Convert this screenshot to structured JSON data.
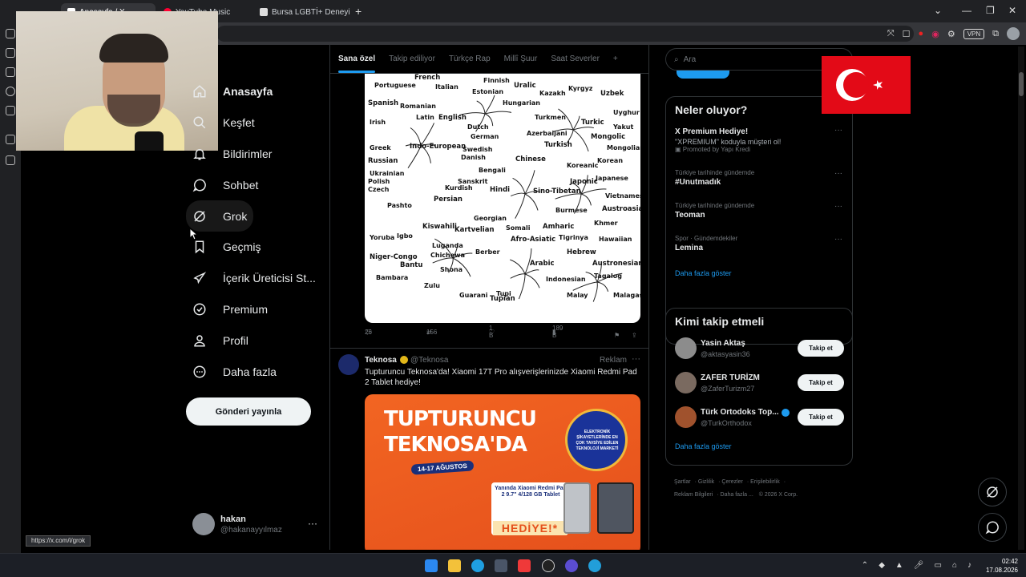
{
  "browser": {
    "tabs": [
      {
        "title": "Anasayfa / X",
        "active": true,
        "color": "#ffffff"
      },
      {
        "title": "YouTube Music",
        "active": false,
        "color": "#ff0033"
      },
      {
        "title": "Bursa LGBTİ+ Deneyimi Öz",
        "active": false,
        "color": "#dddddd"
      }
    ],
    "new_tab": "+",
    "status_url": "https://x.com/i/grok",
    "vpn_label": "VPN"
  },
  "nav": {
    "items": [
      {
        "label": "Anasayfa",
        "icon": "home-icon"
      },
      {
        "label": "Keşfet",
        "icon": "search-icon"
      },
      {
        "label": "Bildirimler",
        "icon": "bell-icon"
      },
      {
        "label": "Sohbet",
        "icon": "chat-icon"
      },
      {
        "label": "Grok",
        "icon": "grok-icon"
      },
      {
        "label": "Geçmiş",
        "icon": "bookmark-icon"
      },
      {
        "label": "İçerik Üreticisi St...",
        "icon": "rocket-icon"
      },
      {
        "label": "Premium",
        "icon": "verified-icon"
      },
      {
        "label": "Profil",
        "icon": "person-icon"
      },
      {
        "label": "Daha fazla",
        "icon": "more-circle-icon"
      }
    ],
    "post_button": "Gönderi yayınla",
    "profile": {
      "name": "hakan",
      "handle": "@hakanayyılmaz",
      "more": "···"
    }
  },
  "timeline": {
    "tabs": [
      "Sana özel",
      "Takip ediliyor",
      "Türkçe Rap",
      "Millî Şuur",
      "Saat Severler"
    ],
    "tab_add": "+",
    "post1": {
      "languages": [
        {
          "text": "French",
          "big": true
        },
        {
          "text": "Portuguese",
          "big": false
        },
        {
          "text": "Italian",
          "big": false
        },
        {
          "text": "Spanish",
          "big": true
        },
        {
          "text": "Romanian",
          "big": false
        },
        {
          "text": "Latin",
          "big": false
        },
        {
          "text": "English",
          "big": true
        },
        {
          "text": "Dutch",
          "big": false
        },
        {
          "text": "German",
          "big": false
        },
        {
          "text": "Swedish",
          "big": false
        },
        {
          "text": "Danish",
          "big": false
        },
        {
          "text": "Irish",
          "big": false
        },
        {
          "text": "Greek",
          "big": false
        },
        {
          "text": "Indo-European",
          "big": true
        },
        {
          "text": "Russian",
          "big": true
        },
        {
          "text": "Ukrainian",
          "big": false
        },
        {
          "text": "Polish",
          "big": false
        },
        {
          "text": "Czech",
          "big": false
        },
        {
          "text": "Pashto",
          "big": false
        },
        {
          "text": "Persian",
          "big": true
        },
        {
          "text": "Kurdish",
          "big": false
        },
        {
          "text": "Bengali",
          "big": false
        },
        {
          "text": "Hindi",
          "big": true
        },
        {
          "text": "Sanskrit",
          "big": false
        },
        {
          "text": "Finnish",
          "big": false
        },
        {
          "text": "Estonian",
          "big": false
        },
        {
          "text": "Uralic",
          "big": true
        },
        {
          "text": "Hungarian",
          "big": false
        },
        {
          "text": "Kazakh",
          "big": false
        },
        {
          "text": "Kyrgyz",
          "big": false
        },
        {
          "text": "Uzbek",
          "big": true
        },
        {
          "text": "Turkmen",
          "big": false
        },
        {
          "text": "Azerbaijani",
          "big": false
        },
        {
          "text": "Turkic",
          "big": true
        },
        {
          "text": "Turkish",
          "big": true
        },
        {
          "text": "Mongolic",
          "big": true
        },
        {
          "text": "Uyghur",
          "big": false
        },
        {
          "text": "Yakut",
          "big": false
        },
        {
          "text": "Mongolian",
          "big": false
        },
        {
          "text": "Chinese",
          "big": true
        },
        {
          "text": "Koreanic",
          "big": false
        },
        {
          "text": "Korean",
          "big": false
        },
        {
          "text": "Japonic",
          "big": true
        },
        {
          "text": "Japanese",
          "big": false
        },
        {
          "text": "Sino-Tibetan",
          "big": true
        },
        {
          "text": "Burmese",
          "big": false
        },
        {
          "text": "Vietnamese",
          "big": false
        },
        {
          "text": "Austroasiatic",
          "big": true
        },
        {
          "text": "Khmer",
          "big": false
        },
        {
          "text": "Georgian",
          "big": false
        },
        {
          "text": "Kartvelian",
          "big": true
        },
        {
          "text": "Kiswahili",
          "big": true
        },
        {
          "text": "Somali",
          "big": false
        },
        {
          "text": "Amharic",
          "big": true
        },
        {
          "text": "Afro-Asiatic",
          "big": true
        },
        {
          "text": "Tigrinya",
          "big": false
        },
        {
          "text": "Hebrew",
          "big": true
        },
        {
          "text": "Arabic",
          "big": true
        },
        {
          "text": "Berber",
          "big": false
        },
        {
          "text": "Yoruba",
          "big": false
        },
        {
          "text": "Igbo",
          "big": false
        },
        {
          "text": "Niger-Congo",
          "big": true
        },
        {
          "text": "Bantu",
          "big": true
        },
        {
          "text": "Luganda",
          "big": false
        },
        {
          "text": "Chichewa",
          "big": false
        },
        {
          "text": "Shona",
          "big": false
        },
        {
          "text": "Zulu",
          "big": false
        },
        {
          "text": "Bambara",
          "big": false
        },
        {
          "text": "Indonesian",
          "big": false
        },
        {
          "text": "Austronesian",
          "big": true
        },
        {
          "text": "Tagalog",
          "big": false
        },
        {
          "text": "Malay",
          "big": false
        },
        {
          "text": "Malagasy",
          "big": false
        },
        {
          "text": "Hawaiian",
          "big": false
        },
        {
          "text": "Tupi",
          "big": false
        },
        {
          "text": "Tupian",
          "big": true
        },
        {
          "text": "Guarani",
          "big": false
        }
      ],
      "stats": {
        "replies": "26",
        "reposts": "156",
        "likes": "1 B",
        "views": "189 B"
      }
    },
    "post2": {
      "name": "Teknosa",
      "handle": "@Teknosa",
      "label": "Reklam",
      "more": "···",
      "text": "Tupturuncu Teknosa'da! Xiaomi 17T Pro alışverişlerinizde Xiaomi Redmi Pad 2 Tablet hediye!",
      "promo": {
        "line1": "TUPTURUNCU",
        "line2": "TEKNOSA'DA",
        "dates": "14-17 AĞUSTOS",
        "badge": "ELEKTRONİK ŞİKAYETLERİNDE EN ÇOK TAVSİYE EDİLEN TEKNOLOJİ MARKETİ",
        "card": "Yanında Xiaomi Redmi Pad 2 9.7\" 4/128 GB Tablet",
        "hediye": "HEDİYE!*"
      }
    }
  },
  "right": {
    "search_placeholder": "Ara",
    "trends_title": "Neler oluyor?",
    "trends": [
      {
        "meta": "",
        "title": "X Premium Hediye!",
        "sub": "\"XPREMIUM\" koduyla müşteri ol!",
        "promoted": "Promoted by Yapı Kredi"
      },
      {
        "meta": "Türkiye tarihinde gündemde",
        "title": "#Unutmadık"
      },
      {
        "meta": "Türkiye tarihinde gündemde",
        "title": "Teoman"
      },
      {
        "meta": "Spor · Gündemdekiler",
        "title": "Lemina"
      }
    ],
    "trends_more": "Daha fazla göster",
    "follow_title": "Kimi takip etmeli",
    "follow": [
      {
        "name": "Yasin Aktaş",
        "handle": "@aktasyasin36",
        "button": "Takip et",
        "verified": false
      },
      {
        "name": "ZAFER TURİZM",
        "handle": "@ZaferTurizm27",
        "button": "Takip et",
        "verified": false
      },
      {
        "name": "Türk Ortodoks Top...",
        "handle": "@TurkOrthodox",
        "button": "Takip et",
        "verified": true
      }
    ],
    "follow_more": "Daha fazla göster",
    "footer": [
      "Şartlar",
      "Gizlilik",
      "Çerezler",
      "Erişilebilirlik",
      "Reklam Bilgileri",
      "Daha fazla ...",
      "© 2026 X Corp."
    ]
  },
  "taskbar": {
    "time": "02:42",
    "date": "17.08.2026"
  },
  "colors": {
    "accent": "#1d9bf0",
    "flag_red": "#e30a17"
  }
}
